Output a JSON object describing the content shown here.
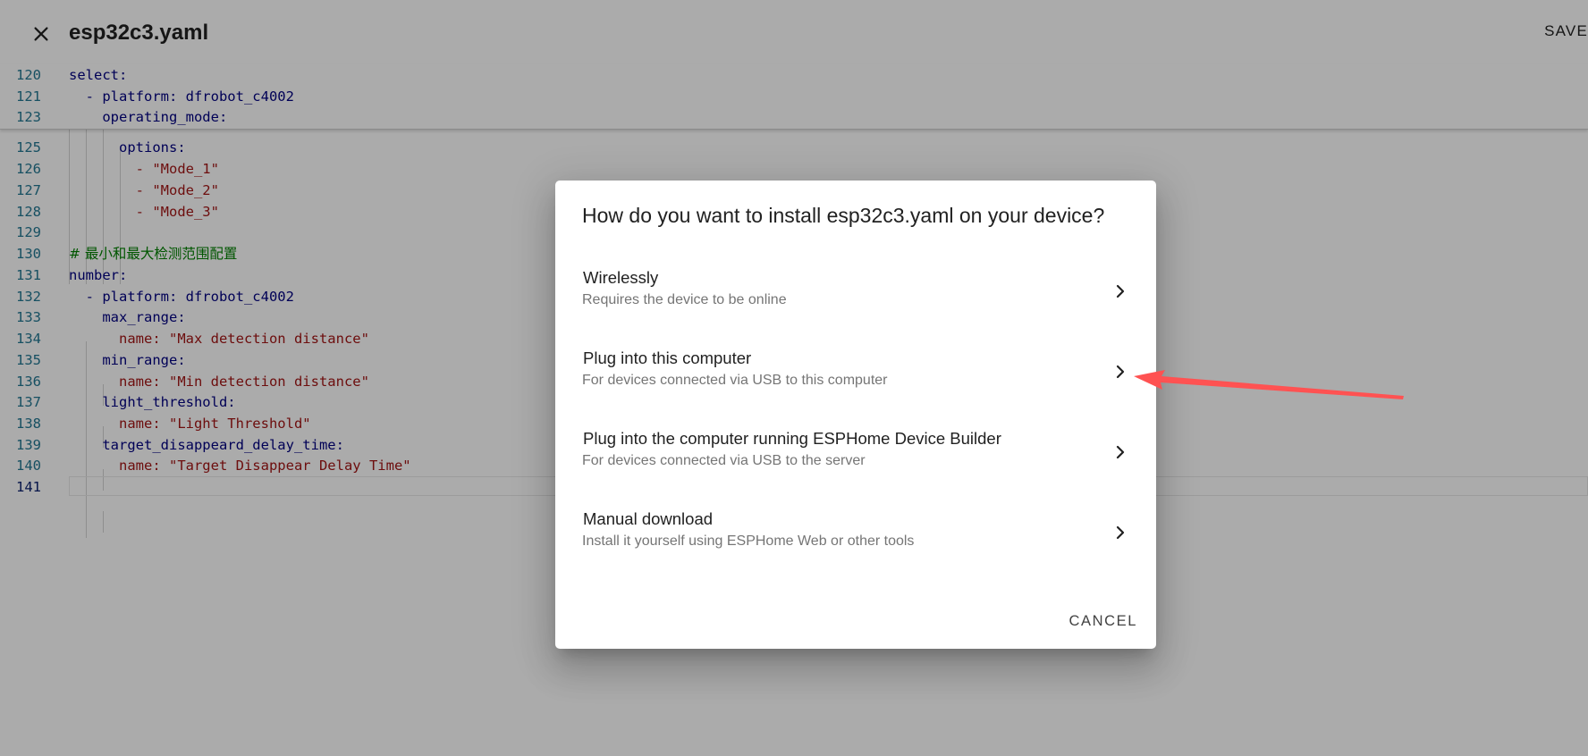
{
  "header": {
    "title": "esp32c3.yaml",
    "save_label": "SAVE"
  },
  "editor": {
    "lines": [
      {
        "n": "120",
        "text": "select:"
      },
      {
        "n": "121",
        "text": "  - platform: dfrobot_c4002"
      },
      {
        "n": "123",
        "text": "    operating_mode:"
      },
      {
        "n": "125",
        "text": "      options:"
      },
      {
        "n": "126",
        "text": "        - \"Mode_1\""
      },
      {
        "n": "127",
        "text": "        - \"Mode_2\""
      },
      {
        "n": "128",
        "text": "        - \"Mode_3\""
      },
      {
        "n": "129",
        "text": ""
      },
      {
        "n": "130",
        "text": "# 最小和最大检测范围配置"
      },
      {
        "n": "131",
        "text": "number:"
      },
      {
        "n": "132",
        "text": "  - platform: dfrobot_c4002"
      },
      {
        "n": "133",
        "text": "    max_range:"
      },
      {
        "n": "134",
        "text": "      name: \"Max detection distance\""
      },
      {
        "n": "135",
        "text": "    min_range:"
      },
      {
        "n": "136",
        "text": "      name: \"Min detection distance\""
      },
      {
        "n": "137",
        "text": "    light_threshold:"
      },
      {
        "n": "138",
        "text": "      name: \"Light Threshold\""
      },
      {
        "n": "139",
        "text": "    target_disappeard_delay_time:"
      },
      {
        "n": "140",
        "text": "      name: \"Target Disappear Delay Time\""
      },
      {
        "n": "141",
        "text": ""
      }
    ]
  },
  "dialog": {
    "title": "How do you want to install esp32c3.yaml on your device?",
    "options": [
      {
        "label": "Wirelessly",
        "desc": "Requires the device to be online"
      },
      {
        "label": "Plug into this computer",
        "desc": "For devices connected via USB to this computer"
      },
      {
        "label": "Plug into the computer running ESPHome Device Builder",
        "desc": "For devices connected via USB to the server"
      },
      {
        "label": "Manual download",
        "desc": "Install it yourself using ESPHome Web or other tools"
      }
    ],
    "cancel_label": "CANCEL"
  },
  "icons": {
    "close": "close-icon",
    "chevron": "chevron-right-icon",
    "annotation": "red-arrow-annotation"
  },
  "colors": {
    "annotation": "#ff5252",
    "string": "#a31515",
    "keyword": "#000080",
    "comment": "#008000",
    "line_number": "#237893"
  }
}
